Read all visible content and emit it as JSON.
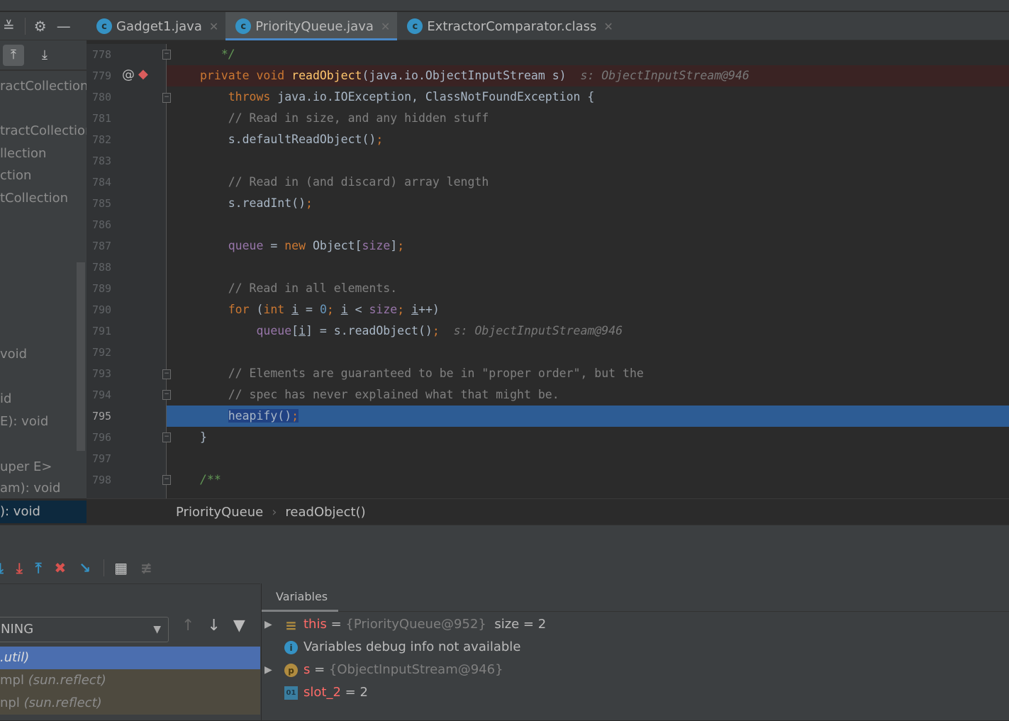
{
  "tabs": [
    {
      "label": "Gadget1.java",
      "active": false
    },
    {
      "label": "PriorityQueue.java",
      "active": true
    },
    {
      "label": "ExtractorComparator.class",
      "active": false
    }
  ],
  "structure": {
    "items": [
      "ractCollection",
      "tractCollection",
      "llection",
      "ction",
      "tCollection",
      "void",
      "id",
      "E): void",
      "uper E>",
      "am): void",
      "): void"
    ]
  },
  "code": [
    {
      "n": "778",
      "t": [
        [
          "   ",
          "t"
        ],
        [
          "*/",
          "d"
        ]
      ]
    },
    {
      "n": "779",
      "bp": true,
      "t": [
        [
          "private void ",
          "k"
        ],
        [
          "readObject",
          "f"
        ],
        [
          "(java.io.ObjectInputStream s)",
          "t"
        ],
        [
          "  s: ObjectInputStream@946",
          "h"
        ]
      ]
    },
    {
      "n": "780",
      "t": [
        [
          "    throws ",
          "k"
        ],
        [
          "java.io.IOException, ClassNotFoundException {",
          "t"
        ]
      ]
    },
    {
      "n": "781",
      "t": [
        [
          "    // Read in size, and any hidden stuff",
          "c"
        ]
      ]
    },
    {
      "n": "782",
      "t": [
        [
          "    s.defaultReadObject()",
          "t"
        ],
        [
          ";",
          "k"
        ]
      ]
    },
    {
      "n": "783",
      "t": []
    },
    {
      "n": "784",
      "t": [
        [
          "    // Read in (and discard) array length",
          "c"
        ]
      ]
    },
    {
      "n": "785",
      "t": [
        [
          "    s.readInt()",
          "t"
        ],
        [
          ";",
          "k"
        ]
      ]
    },
    {
      "n": "786",
      "t": []
    },
    {
      "n": "787",
      "t": [
        [
          "    ",
          "t"
        ],
        [
          "queue",
          "p"
        ],
        [
          " = ",
          "t"
        ],
        [
          "new ",
          "k"
        ],
        [
          "Object[",
          "t"
        ],
        [
          "size",
          "p"
        ],
        [
          "]",
          "t"
        ],
        [
          ";",
          "k"
        ]
      ]
    },
    {
      "n": "788",
      "t": []
    },
    {
      "n": "789",
      "t": [
        [
          "    // Read in all elements.",
          "c"
        ]
      ]
    },
    {
      "n": "790",
      "t": [
        [
          "    ",
          "t"
        ],
        [
          "for ",
          "k"
        ],
        [
          "(",
          "t"
        ],
        [
          "int ",
          "k"
        ],
        [
          "i",
          "u"
        ],
        [
          " = ",
          "t"
        ],
        [
          "0",
          "n"
        ],
        [
          "; ",
          "k"
        ],
        [
          "i",
          "u"
        ],
        [
          " < ",
          "t"
        ],
        [
          "size",
          "p"
        ],
        [
          "; ",
          "k"
        ],
        [
          "i",
          "u"
        ],
        [
          "++)",
          "t"
        ]
      ]
    },
    {
      "n": "791",
      "t": [
        [
          "        ",
          "t"
        ],
        [
          "queue",
          "p"
        ],
        [
          "[",
          "t"
        ],
        [
          "i",
          "u"
        ],
        [
          "] = s.readObject()",
          "t"
        ],
        [
          ";",
          "k"
        ],
        [
          "  s: ObjectInputStream@946",
          "h"
        ]
      ]
    },
    {
      "n": "792",
      "t": []
    },
    {
      "n": "793",
      "t": [
        [
          "    // Elements are guaranteed to be in \"proper order\", but the",
          "c"
        ]
      ]
    },
    {
      "n": "794",
      "t": [
        [
          "    // spec has never explained what that might be.",
          "c"
        ]
      ]
    },
    {
      "n": "795",
      "cur": true,
      "t": [
        [
          "    ",
          "t"
        ],
        [
          "heapify()",
          "sel"
        ],
        [
          ";",
          "selk"
        ]
      ]
    },
    {
      "n": "796",
      "t": [
        [
          "}",
          "t"
        ]
      ]
    },
    {
      "n": "797",
      "t": []
    },
    {
      "n": "798",
      "t": [
        [
          "/**",
          "d"
        ]
      ]
    }
  ],
  "breadcrumb": [
    "PriorityQueue",
    "readObject()"
  ],
  "debugger": {
    "thread_select": "NING",
    "frames": [
      {
        "name": "",
        "pkg": ".util)",
        "selected": true
      },
      {
        "name": "mpl ",
        "pkg": "(sun.reflect)",
        "selected": false
      },
      {
        "name": "npl ",
        "pkg": "(sun.reflect)",
        "selected": false
      }
    ],
    "variables_tab": "Variables",
    "variables": [
      {
        "icon": "field-icon",
        "name": "this",
        "value": "{PriorityQueue@952}",
        "extra": "size = 2",
        "expandable": true
      },
      {
        "icon": "info-icon",
        "message": "Variables debug info not available"
      },
      {
        "icon": "parameter-icon",
        "name": "s",
        "value": "{ObjectInputStream@946}",
        "expandable": true
      },
      {
        "icon": "primitive-icon",
        "name": "slot_2",
        "value": "2"
      }
    ]
  },
  "colors": {
    "accent": "#4a88c7",
    "breakpoint_line": "#3a2323",
    "execution_line": "#2d5c94"
  }
}
